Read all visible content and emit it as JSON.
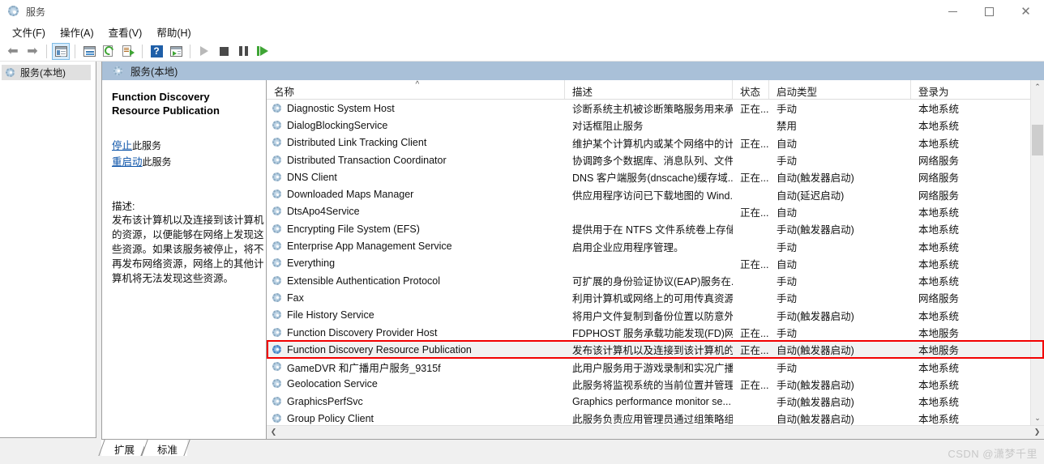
{
  "window": {
    "title": "服务",
    "icon": "services-gear-icon",
    "minimize_label": "最小化",
    "maximize_label": "最大化",
    "close_label": "关闭"
  },
  "menu": [
    {
      "label": "文件(F)",
      "name": "menu-file"
    },
    {
      "label": "操作(A)",
      "name": "menu-action"
    },
    {
      "label": "查看(V)",
      "name": "menu-view"
    },
    {
      "label": "帮助(H)",
      "name": "menu-help"
    }
  ],
  "toolbar": [
    {
      "name": "back-icon",
      "glyph": "⬅",
      "kind": "arrow"
    },
    {
      "name": "forward-icon",
      "glyph": "➡",
      "kind": "arrow"
    },
    {
      "name": "show-hide-tree-icon",
      "kind": "window",
      "active": true
    },
    {
      "name": "properties-icon",
      "kind": "prop"
    },
    {
      "name": "refresh-icon",
      "kind": "refresh"
    },
    {
      "name": "export-list-icon",
      "kind": "export"
    },
    {
      "name": "help-icon",
      "kind": "help",
      "glyph": "?"
    },
    {
      "name": "display-icon",
      "kind": "display"
    },
    {
      "name": "start-service-icon",
      "kind": "play"
    },
    {
      "name": "stop-service-icon",
      "kind": "stop"
    },
    {
      "name": "pause-service-icon",
      "kind": "pause"
    },
    {
      "name": "restart-service-icon",
      "kind": "restart"
    }
  ],
  "tree": {
    "root_label": "服务(本地)"
  },
  "content": {
    "header_label": "服务(本地)"
  },
  "detail": {
    "service_title": "Function Discovery Resource Publication",
    "stop_link": "停止",
    "stop_suffix": "此服务",
    "restart_link": "重启动",
    "restart_suffix": "此服务",
    "description_label": "描述:",
    "description_text": "发布该计算机以及连接到该计算机的资源，以便能够在网络上发现这些资源。如果该服务被停止，将不再发布网络资源，网络上的其他计算机将无法发现这些资源。"
  },
  "list": {
    "columns": [
      {
        "key": "name",
        "label": "名称",
        "sorted": true,
        "sort_glyph": "^"
      },
      {
        "key": "description",
        "label": "描述"
      },
      {
        "key": "status",
        "label": "状态"
      },
      {
        "key": "startup",
        "label": "启动类型"
      },
      {
        "key": "logon",
        "label": "登录为"
      }
    ],
    "selected_row_index": 14,
    "highlight_color": "#f20000",
    "rows": [
      {
        "name": "Diagnostic System Host",
        "description": "诊断系统主机被诊断策略服务用来承...",
        "status": "正在...",
        "startup": "手动",
        "logon": "本地系统"
      },
      {
        "name": "DialogBlockingService",
        "description": "对话框阻止服务",
        "status": "",
        "startup": "禁用",
        "logon": "本地系统"
      },
      {
        "name": "Distributed Link Tracking Client",
        "description": "维护某个计算机内或某个网络中的计...",
        "status": "正在...",
        "startup": "自动",
        "logon": "本地系统"
      },
      {
        "name": "Distributed Transaction Coordinator",
        "description": "协调跨多个数据库、消息队列、文件...",
        "status": "",
        "startup": "手动",
        "logon": "网络服务"
      },
      {
        "name": "DNS Client",
        "description": "DNS 客户端服务(dnscache)缓存域...",
        "status": "正在...",
        "startup": "自动(触发器启动)",
        "logon": "网络服务"
      },
      {
        "name": "Downloaded Maps Manager",
        "description": "供应用程序访问已下载地图的 Wind...",
        "status": "",
        "startup": "自动(延迟启动)",
        "logon": "网络服务"
      },
      {
        "name": "DtsApo4Service",
        "description": "",
        "status": "正在...",
        "startup": "自动",
        "logon": "本地系统"
      },
      {
        "name": "Encrypting File System (EFS)",
        "description": "提供用于在 NTFS 文件系统卷上存储...",
        "status": "",
        "startup": "手动(触发器启动)",
        "logon": "本地系统"
      },
      {
        "name": "Enterprise App Management Service",
        "description": "启用企业应用程序管理。",
        "status": "",
        "startup": "手动",
        "logon": "本地系统"
      },
      {
        "name": "Everything",
        "description": "",
        "status": "正在...",
        "startup": "自动",
        "logon": "本地系统"
      },
      {
        "name": "Extensible Authentication Protocol",
        "description": "可扩展的身份验证协议(EAP)服务在...",
        "status": "",
        "startup": "手动",
        "logon": "本地系统"
      },
      {
        "name": "Fax",
        "description": "利用计算机或网络上的可用传真资源...",
        "status": "",
        "startup": "手动",
        "logon": "网络服务"
      },
      {
        "name": "File History Service",
        "description": "将用户文件复制到备份位置以防意外...",
        "status": "",
        "startup": "手动(触发器启动)",
        "logon": "本地系统"
      },
      {
        "name": "Function Discovery Provider Host",
        "description": "FDPHOST 服务承载功能发现(FD)网...",
        "status": "正在...",
        "startup": "手动",
        "logon": "本地服务"
      },
      {
        "name": "Function Discovery Resource Publication",
        "description": "发布该计算机以及连接到该计算机的...",
        "status": "正在...",
        "startup": "自动(触发器启动)",
        "logon": "本地服务"
      },
      {
        "name": "GameDVR 和广播用户服务_9315f",
        "description": "此用户服务用于游戏录制和实况广播",
        "status": "",
        "startup": "手动",
        "logon": "本地系统"
      },
      {
        "name": "Geolocation Service",
        "description": "此服务将监视系统的当前位置并管理...",
        "status": "正在...",
        "startup": "手动(触发器启动)",
        "logon": "本地系统"
      },
      {
        "name": "GraphicsPerfSvc",
        "description": "Graphics performance monitor se...",
        "status": "",
        "startup": "手动(触发器启动)",
        "logon": "本地系统"
      },
      {
        "name": "Group Policy Client",
        "description": "此服务负责应用管理员通过组策略组...",
        "status": "",
        "startup": "自动(触发器启动)",
        "logon": "本地系统"
      }
    ]
  },
  "scroll": {
    "up_glyph": "⌃",
    "down_glyph": "⌄",
    "left_glyph": "❮",
    "right_glyph": "❯"
  },
  "tabs": [
    {
      "label": "扩展",
      "name": "tab-extended",
      "active": false
    },
    {
      "label": "标准",
      "name": "tab-standard",
      "active": true
    }
  ],
  "watermark": "CSDN @潇梦千里"
}
